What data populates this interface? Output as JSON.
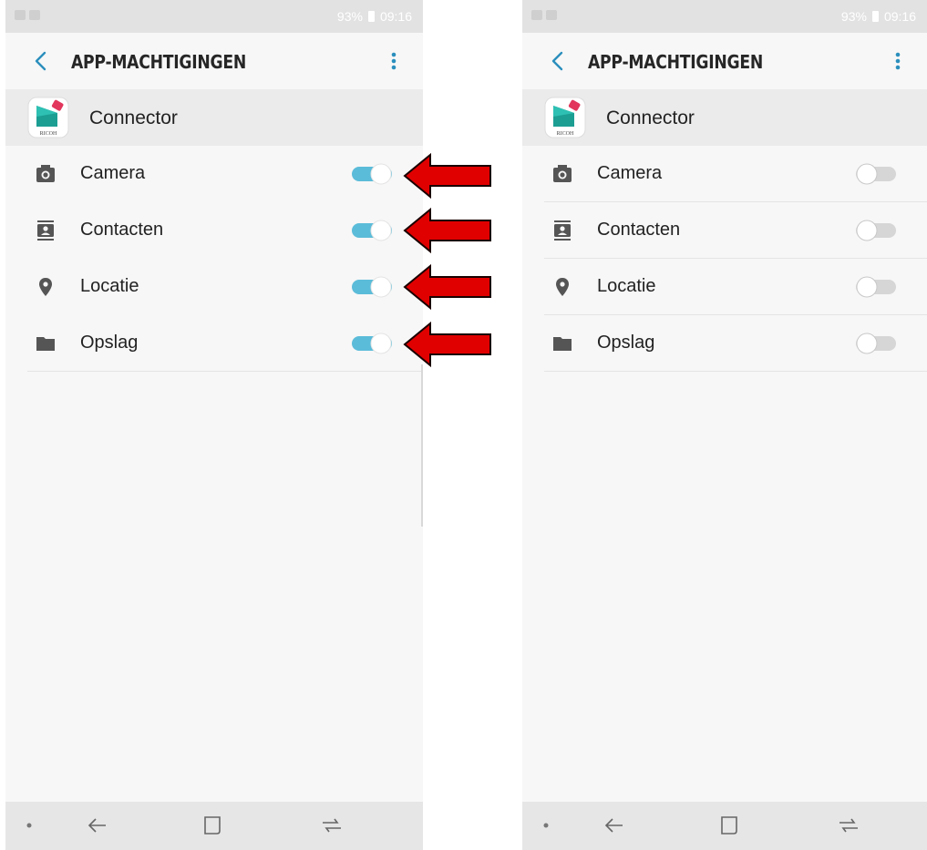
{
  "status_bar": {
    "battery": "93%",
    "time": "09:16"
  },
  "appbar": {
    "title": "APP-MACHTIGINGEN",
    "back_icon": "chevron-left-icon",
    "more_icon": "more-vert-icon"
  },
  "app": {
    "name": "Connector",
    "icon_text": "RICOH"
  },
  "permissions": [
    {
      "label": "Camera",
      "icon": "camera-icon"
    },
    {
      "label": "Contacten",
      "icon": "contacts-icon"
    },
    {
      "label": "Locatie",
      "icon": "location-pin-icon"
    },
    {
      "label": "Opslag",
      "icon": "folder-icon"
    }
  ],
  "left_screen": {
    "toggles_on": [
      true,
      true,
      true,
      true
    ]
  },
  "right_screen": {
    "toggles_on": [
      false,
      false,
      false,
      false
    ]
  },
  "annotation_arrows": 4,
  "colors": {
    "toggle_on": "#5bbcd9",
    "toggle_off": "#cfcfcf",
    "arrow": "#e10000",
    "accent": "#2b8fbd"
  }
}
